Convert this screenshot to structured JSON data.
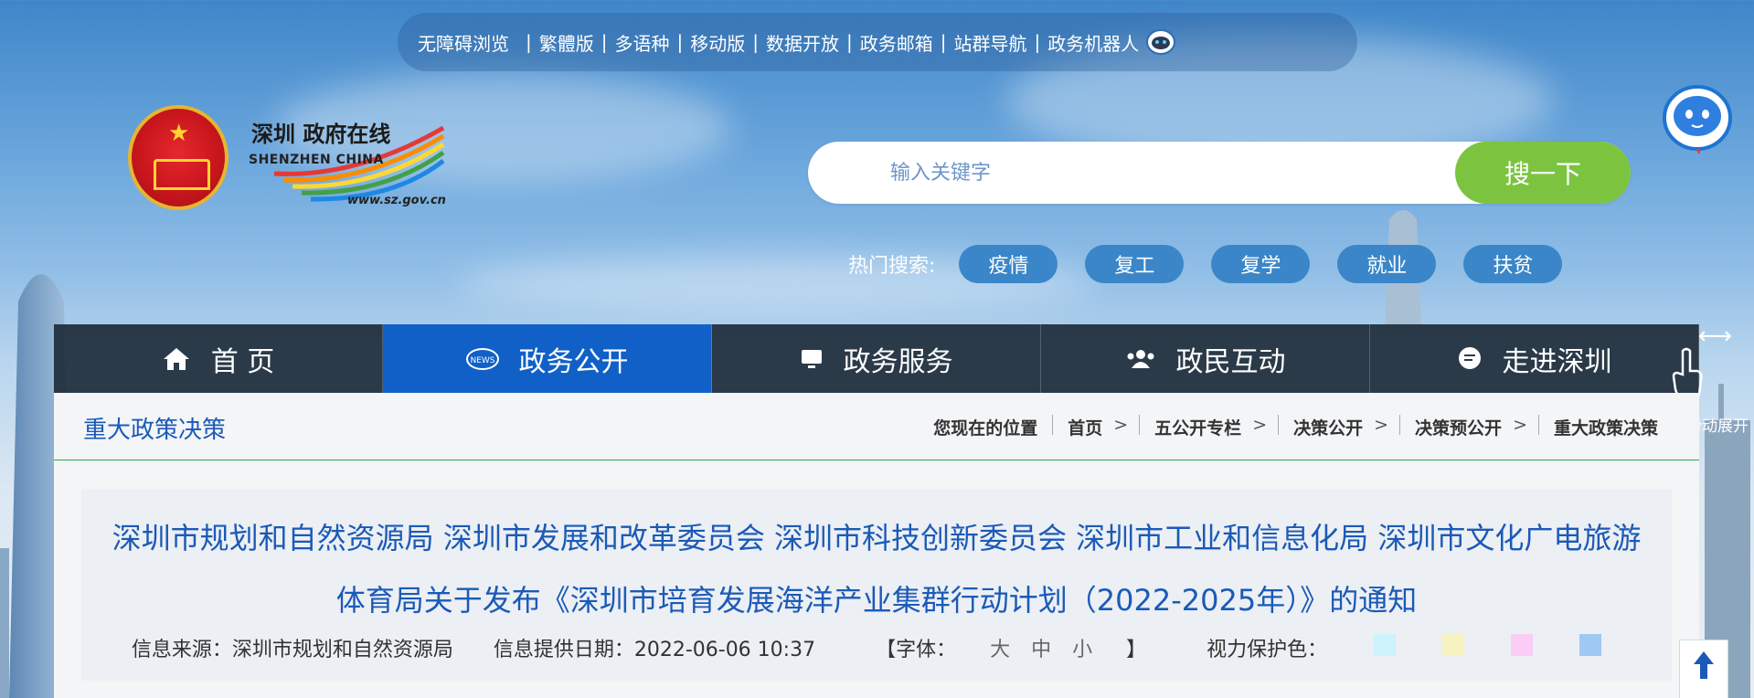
{
  "top_links": {
    "items": [
      "无障碍浏览",
      "繁體版",
      "多语种",
      "移动版",
      "数据开放",
      "政务邮箱",
      "站群导航",
      "政务机器人"
    ]
  },
  "logo": {
    "cn_text": "深圳 政府在线",
    "en_text": "SHENZHEN CHINA",
    "url_text": "www.sz.gov.cn"
  },
  "search": {
    "placeholder": "输入关键字",
    "button_label": "搜一下"
  },
  "hot_search": {
    "label": "热门搜索:",
    "tags": [
      "疫情",
      "复工",
      "复学",
      "就业",
      "扶贫"
    ]
  },
  "nav": {
    "items": [
      {
        "label": "首 页",
        "icon": "home-icon"
      },
      {
        "label": "政务公开",
        "icon": "news-icon"
      },
      {
        "label": "政务服务",
        "icon": "monitor-icon"
      },
      {
        "label": "政民互动",
        "icon": "people-icon"
      },
      {
        "label": "走进深圳",
        "icon": "chat-icon"
      }
    ],
    "active_index": 1
  },
  "side": {
    "expand_text": "滑动展开"
  },
  "content": {
    "section_title": "重大政策决策",
    "breadcrumb_label": "您现在的位置",
    "breadcrumb": [
      "首页",
      "五公开专栏",
      "决策公开",
      "决策预公开",
      "重大政策决策"
    ],
    "article_title": "深圳市规划和自然资源局 深圳市发展和改革委员会 深圳市科技创新委员会 深圳市工业和信息化局 深圳市文化广电旅游体育局关于发布《深圳市培育发展海洋产业集群行动计划（2022-2025年）》的通知",
    "source": "信息来源：深圳市规划和自然资源局",
    "date": "信息提供日期：2022-06-06 10:37",
    "font_label": "【字体：",
    "font_sizes": [
      "大",
      "中",
      "小"
    ],
    "font_close": "】",
    "eye_label": "视力保护色：",
    "eye_colors": [
      "#ccf3fb",
      "#f6f3c0",
      "#fbccf6",
      "#9fc9f3"
    ]
  },
  "colors": {
    "nav_active": "#1160c8",
    "search_button": "#7cc440",
    "link_blue": "#1a5ab8"
  }
}
